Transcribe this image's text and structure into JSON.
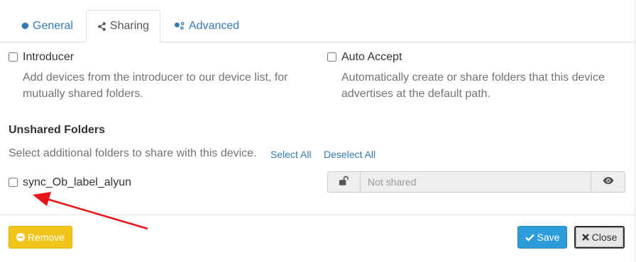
{
  "tabs": {
    "general": "General",
    "sharing": "Sharing",
    "advanced": "Advanced"
  },
  "introducer": {
    "label": "Introducer",
    "checked": false,
    "help": "Add devices from the introducer to our device list, for mutually shared folders."
  },
  "auto_accept": {
    "label": "Auto Accept",
    "checked": false,
    "help": "Automatically create or share folders that this device advertises at the default path."
  },
  "unshared": {
    "title": "Unshared Folders",
    "help": "Select additional folders to share with this device.",
    "select_all": "Select All",
    "deselect_all": "Deselect All",
    "folders": [
      {
        "label": "sync_Ob_label_alyun",
        "checked": false,
        "password_placeholder": "Not shared"
      }
    ]
  },
  "footer": {
    "remove": "Remove",
    "save": "Save",
    "close": "Close"
  },
  "colors": {
    "link": "#337ab7",
    "warning": "#f0c419",
    "primary": "#2d9cdb",
    "arrow": "#e8141a"
  },
  "icons": {
    "general": "gear-icon",
    "sharing": "share-icon",
    "advanced": "gears-icon",
    "lock": "unlock-icon",
    "eye": "eye-icon",
    "remove": "minus-circle-icon",
    "save": "check-icon",
    "close": "times-icon"
  }
}
